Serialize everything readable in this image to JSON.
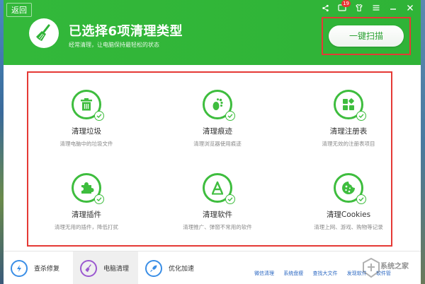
{
  "header": {
    "back_label": "返回",
    "title": "已选择6项清理类型",
    "subtitle": "经常清理，让电脑保持最轻松的状态",
    "scan_button": "一键扫描",
    "notify_count": "19"
  },
  "items": [
    {
      "name": "清理垃圾",
      "desc": "清理电脑中的垃圾文件",
      "icon": "trash-icon"
    },
    {
      "name": "清理痕迹",
      "desc": "清理浏览器使用痕迹",
      "icon": "footprint-icon"
    },
    {
      "name": "清理注册表",
      "desc": "清理无效的注册表项目",
      "icon": "registry-icon"
    },
    {
      "name": "清理插件",
      "desc": "清理无用的插件，降低打扰",
      "icon": "puzzle-icon"
    },
    {
      "name": "清理软件",
      "desc": "清理推广、弹窗不常用的软件",
      "icon": "app-icon"
    },
    {
      "name": "清理Cookies",
      "desc": "清理上网、游戏、购物等记录",
      "icon": "cookie-icon"
    }
  ],
  "tabs": [
    {
      "label": "查杀修复",
      "icon": "shield-bolt-icon"
    },
    {
      "label": "电脑清理",
      "icon": "broom-icon"
    },
    {
      "label": "优化加速",
      "icon": "rocket-icon"
    }
  ],
  "bottom_links": [
    "微信清理",
    "系统盘瘦",
    "查找大文件",
    "发现软件",
    "软件管"
  ],
  "watermark_text": "系统之家",
  "colors": {
    "brand_green": "#2fb337",
    "highlight_red": "#e53935",
    "icon_green": "#3ebd3e"
  }
}
